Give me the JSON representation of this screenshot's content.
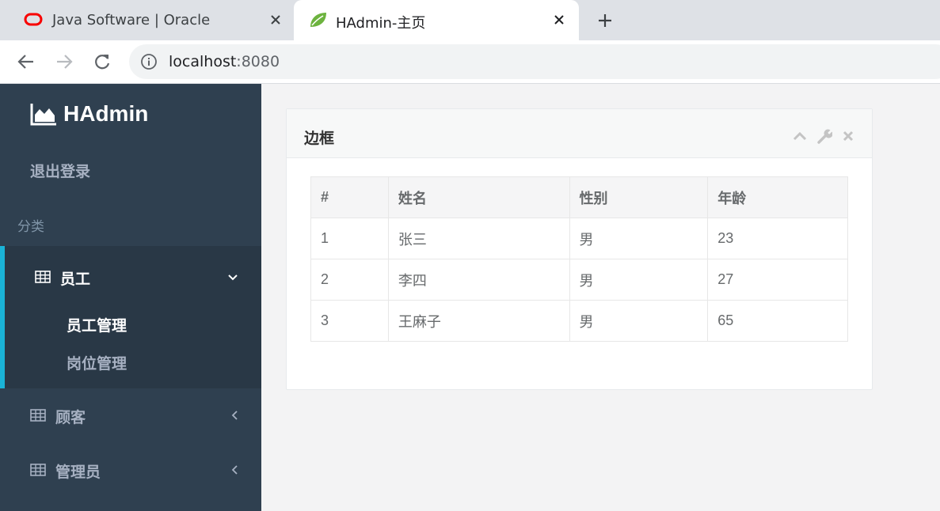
{
  "browser": {
    "tabs": [
      {
        "title": "Java Software | Oracle",
        "active": false,
        "favicon": "oracle-logo-icon"
      },
      {
        "title": "HAdmin-主页",
        "active": true,
        "favicon": "spring-leaf-icon"
      }
    ],
    "new_tab_icon": "plus-icon",
    "address": {
      "host": "localhost",
      "port": ":8080"
    },
    "colors": {
      "tabbar": "#dee1e6",
      "oracle_red": "#f80000",
      "spring_green": "#6db33f"
    }
  },
  "sidebar": {
    "brand": "HAdmin",
    "brand_icon": "area-chart-icon",
    "logout": "退出登录",
    "section_label": "分类",
    "menus": [
      {
        "label": "员工",
        "icon": "table-icon",
        "expanded": true,
        "arrow_icon": "chevron-down-icon",
        "children": [
          "员工管理",
          "岗位管理"
        ]
      },
      {
        "label": "顾客",
        "icon": "table-icon",
        "expanded": false,
        "arrow_icon": "chevron-left-icon"
      },
      {
        "label": "管理员",
        "icon": "table-icon",
        "expanded": false,
        "arrow_icon": "chevron-left-icon"
      }
    ],
    "colors": {
      "background": "#2f4050",
      "active_background": "#293846",
      "active_border": "#1ab3d7"
    }
  },
  "panel": {
    "title": "边框",
    "tools": [
      "chevron-up-icon",
      "wrench-icon",
      "close-icon"
    ],
    "table": {
      "columns": [
        "#",
        "姓名",
        "性别",
        "年龄"
      ],
      "rows": [
        [
          "1",
          "张三",
          "男",
          "23"
        ],
        [
          "2",
          "李四",
          "男",
          "27"
        ],
        [
          "3",
          "王麻子",
          "男",
          "65"
        ]
      ]
    }
  }
}
